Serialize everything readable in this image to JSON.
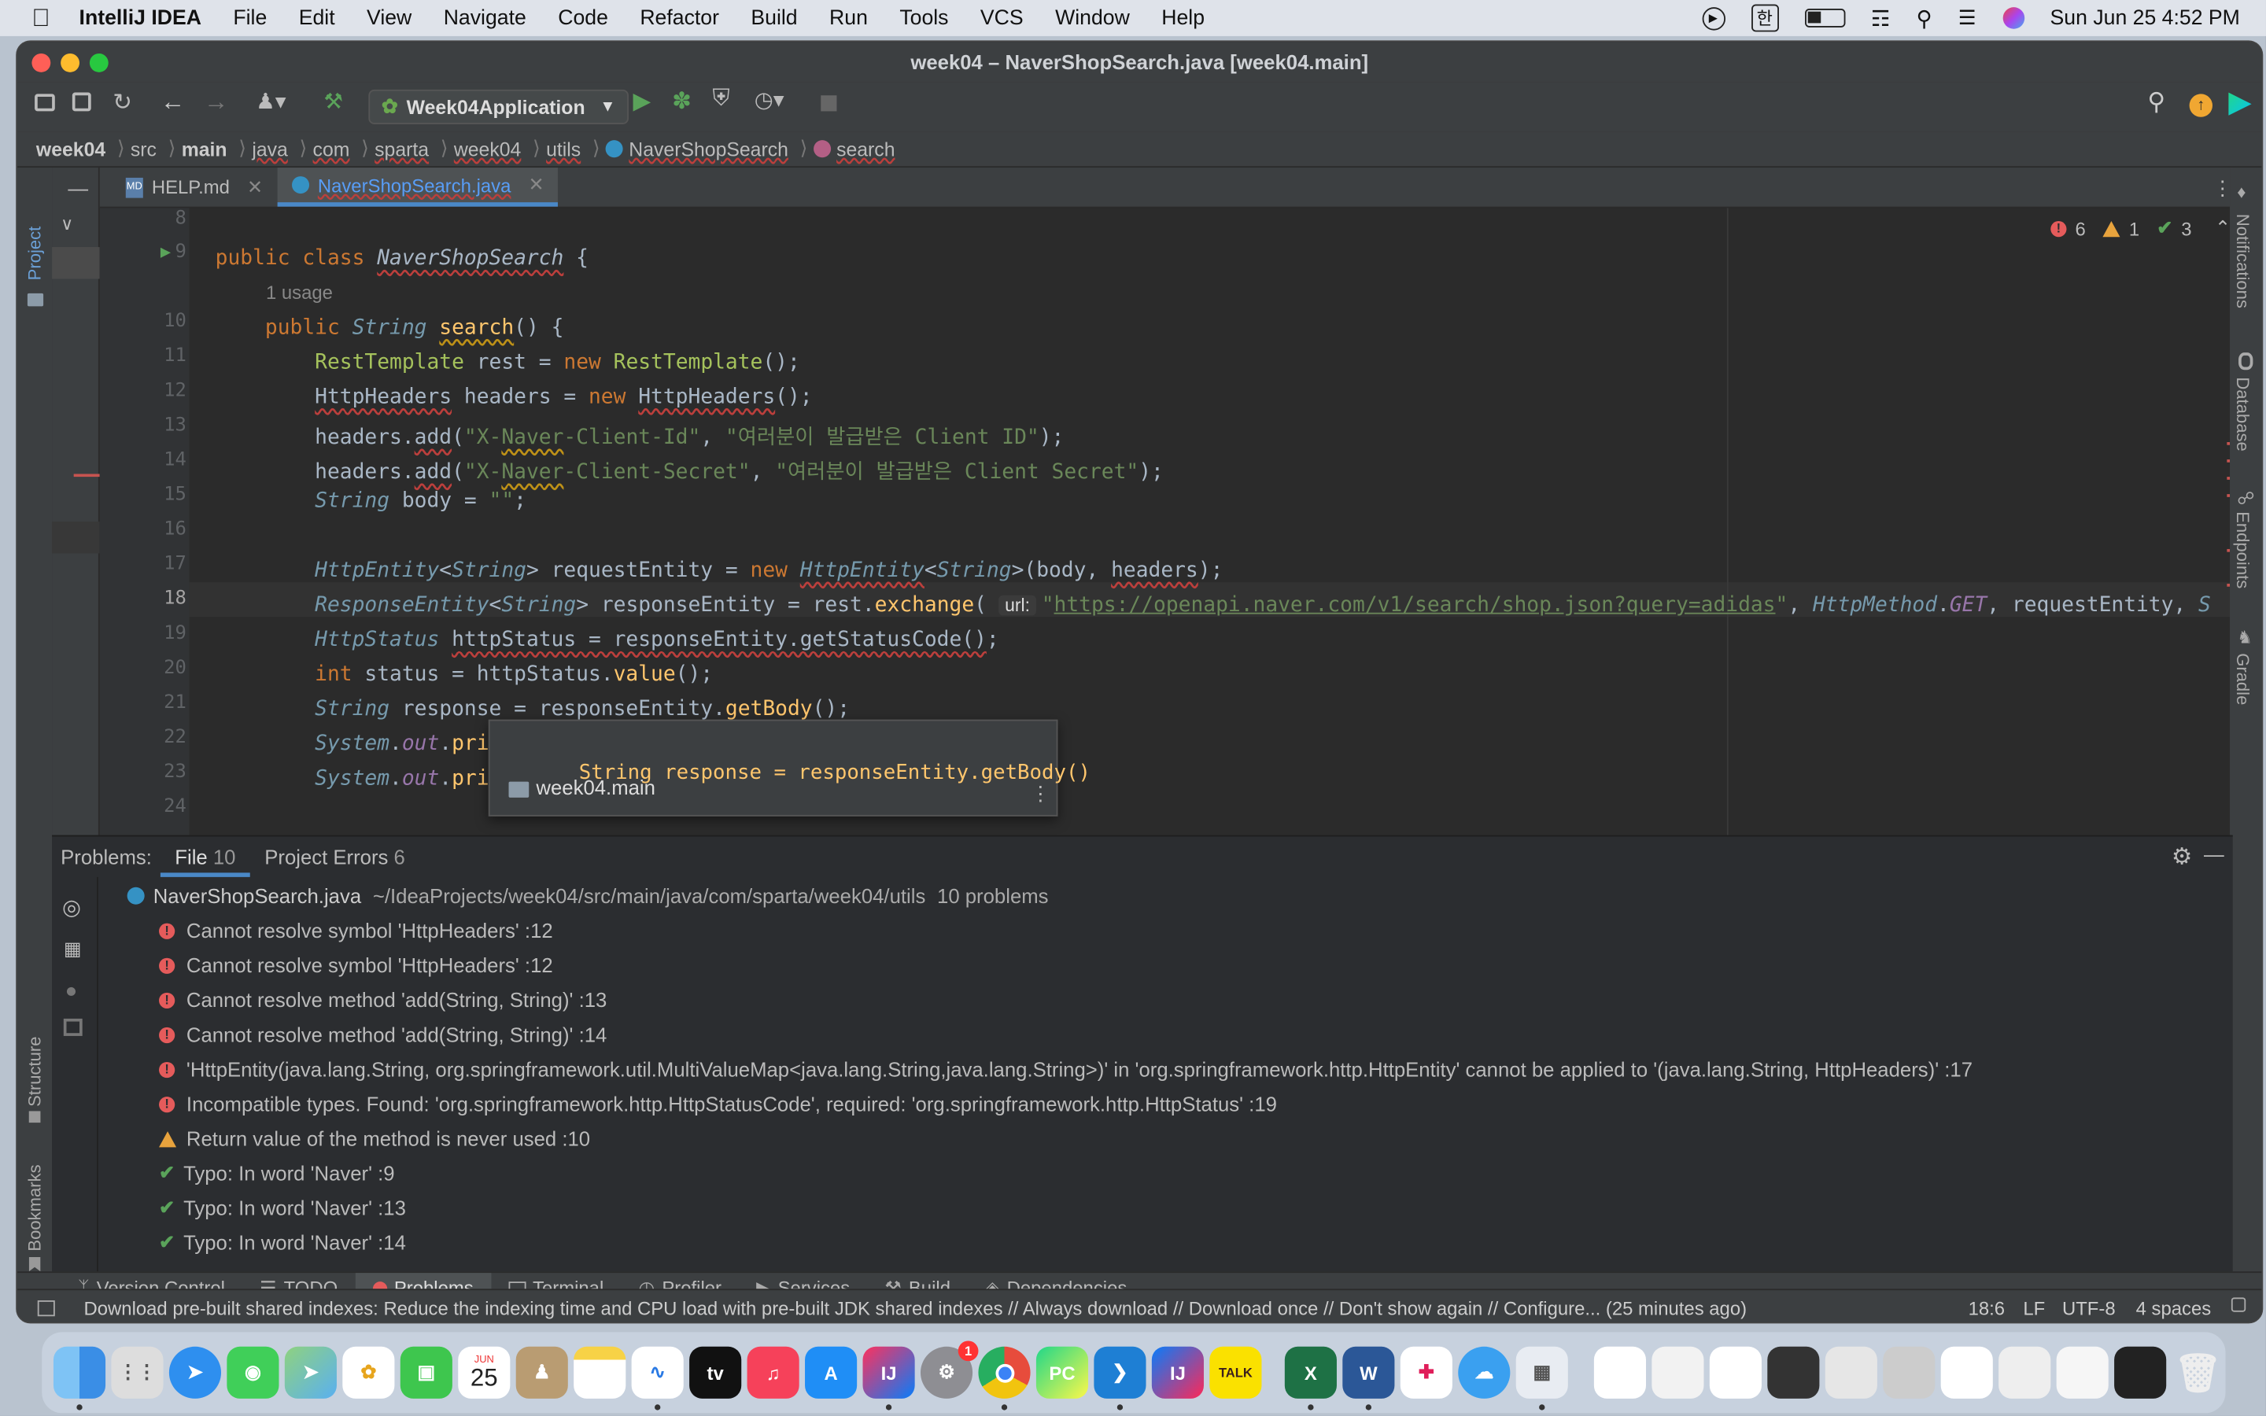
{
  "menubar": {
    "app": "IntelliJ IDEA",
    "items": [
      "File",
      "Edit",
      "View",
      "Navigate",
      "Code",
      "Refactor",
      "Build",
      "Run",
      "Tools",
      "VCS",
      "Window",
      "Help"
    ],
    "input_source": "한",
    "datetime": "Sun Jun 25  4:52 PM"
  },
  "window": {
    "title": "week04 – NaverShopSearch.java [week04.main]",
    "run_config": "Week04Application"
  },
  "breadcrumbs": [
    "week04",
    "src",
    "main",
    "java",
    "com",
    "sparta",
    "week04",
    "utils",
    "NaverShopSearch",
    "search"
  ],
  "tabs": [
    {
      "label": "HELP.md",
      "active": false
    },
    {
      "label": "NaverShopSearch.java",
      "active": true
    }
  ],
  "inspections": {
    "errors": "6",
    "warnings": "1",
    "typos": "3"
  },
  "side_labels": {
    "project": "Project",
    "structure": "Structure",
    "bookmarks": "Bookmarks",
    "notifications": "Notifications",
    "database": "Database",
    "endpoints": "Endpoints",
    "gradle": "Gradle"
  },
  "editor": {
    "usage_hint": "1 usage",
    "line_numbers": [
      "8",
      "9",
      "10",
      "11",
      "12",
      "13",
      "14",
      "15",
      "16",
      "17",
      "18",
      "19",
      "20",
      "21",
      "22",
      "23",
      "24"
    ],
    "current_line": "18",
    "url_hint": "url:"
  },
  "popup": {
    "code": "String response = responseEntity.getBody()",
    "module": "week04.main"
  },
  "problems": {
    "title": "Problems:",
    "tab_file": "File",
    "tab_file_count": "10",
    "tab_project": "Project Errors",
    "tab_project_count": "6",
    "file_header": "NaverShopSearch.java",
    "file_path": "~/IdeaProjects/week04/src/main/java/com/sparta/week04/utils",
    "file_count": "10 problems",
    "rows": [
      {
        "kind": "error",
        "text": "Cannot resolve symbol 'HttpHeaders' :12"
      },
      {
        "kind": "error",
        "text": "Cannot resolve symbol 'HttpHeaders' :12"
      },
      {
        "kind": "error",
        "text": "Cannot resolve method 'add(String, String)' :13"
      },
      {
        "kind": "error",
        "text": "Cannot resolve method 'add(String, String)' :14"
      },
      {
        "kind": "error",
        "text": "'HttpEntity(java.lang.String, org.springframework.util.MultiValueMap<java.lang.String,java.lang.String>)' in 'org.springframework.http.HttpEntity' cannot be applied to '(java.lang.String, HttpHeaders)' :17"
      },
      {
        "kind": "error",
        "text": "Incompatible types. Found: 'org.springframework.http.HttpStatusCode', required: 'org.springframework.http.HttpStatus' :19"
      },
      {
        "kind": "warning",
        "text": "Return value of the method is never used :10"
      },
      {
        "kind": "typo",
        "text": "Typo: In word 'Naver' :9"
      },
      {
        "kind": "typo",
        "text": "Typo: In word 'Naver' :13"
      },
      {
        "kind": "typo",
        "text": "Typo: In word 'Naver' :14"
      }
    ]
  },
  "bottom_tabs": [
    "Version Control",
    "TODO",
    "Problems",
    "Terminal",
    "Profiler",
    "Services",
    "Build",
    "Dependencies"
  ],
  "status": {
    "message": "Download pre-built shared indexes: Reduce the indexing time and CPU load with pre-built JDK shared indexes // Always download // Download once // Don't show again // Configure... (25 minutes ago)",
    "position": "18:6",
    "line_sep": "LF",
    "encoding": "UTF-8",
    "indent": "4 spaces"
  },
  "dock": {
    "calendar_month": "JUN",
    "calendar_day": "25",
    "settings_badge": "1",
    "apps": [
      "finder",
      "launchpad",
      "safari",
      "messages",
      "maps",
      "photos",
      "facetime",
      "calendar",
      "contacts",
      "notes",
      "freeform",
      "apple-tv",
      "music",
      "app-store",
      "intellij",
      "system-settings",
      "chrome",
      "pycharm",
      "vscode",
      "intellij-ce",
      "kakaotalk",
      "excel",
      "word",
      "slack",
      "icloud",
      "preview",
      "trash"
    ]
  },
  "colors": {
    "accent": "#4a88c7",
    "error": "#e55b5b",
    "warning": "#e8a33d",
    "ok": "#5aa35a"
  }
}
